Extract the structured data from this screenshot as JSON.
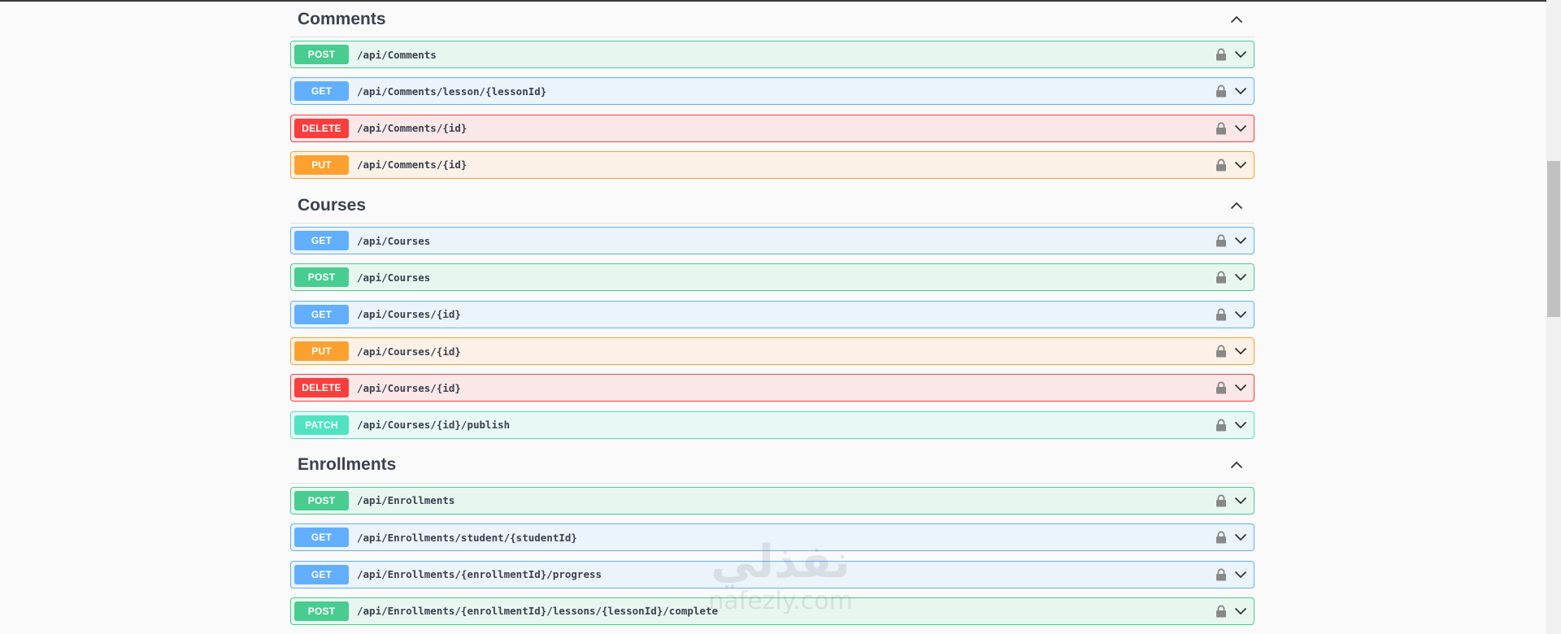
{
  "colors": {
    "post": "#49cc90",
    "get": "#61affe",
    "delete": "#f93e3e",
    "put": "#fca130",
    "patch": "#50e3c2",
    "text": "#3b4151"
  },
  "icons": {
    "lock": "lock-icon",
    "expand": "chevron-down-icon",
    "collapse": "chevron-up-icon"
  },
  "sections": [
    {
      "title": "Comments",
      "operations": [
        {
          "method": "POST",
          "path": "/api/Comments"
        },
        {
          "method": "GET",
          "path": "/api/Comments/lesson/{lessonId}"
        },
        {
          "method": "DELETE",
          "path": "/api/Comments/{id}"
        },
        {
          "method": "PUT",
          "path": "/api/Comments/{id}"
        }
      ]
    },
    {
      "title": "Courses",
      "operations": [
        {
          "method": "GET",
          "path": "/api/Courses"
        },
        {
          "method": "POST",
          "path": "/api/Courses"
        },
        {
          "method": "GET",
          "path": "/api/Courses/{id}"
        },
        {
          "method": "PUT",
          "path": "/api/Courses/{id}"
        },
        {
          "method": "DELETE",
          "path": "/api/Courses/{id}"
        },
        {
          "method": "PATCH",
          "path": "/api/Courses/{id}/publish"
        }
      ]
    },
    {
      "title": "Enrollments",
      "operations": [
        {
          "method": "POST",
          "path": "/api/Enrollments"
        },
        {
          "method": "GET",
          "path": "/api/Enrollments/student/{studentId}"
        },
        {
          "method": "GET",
          "path": "/api/Enrollments/{enrollmentId}/progress"
        },
        {
          "method": "POST",
          "path": "/api/Enrollments/{enrollmentId}/lessons/{lessonId}/complete"
        }
      ]
    }
  ],
  "watermark": {
    "arabic": "نفذلي",
    "latin": "nafezly.com"
  }
}
